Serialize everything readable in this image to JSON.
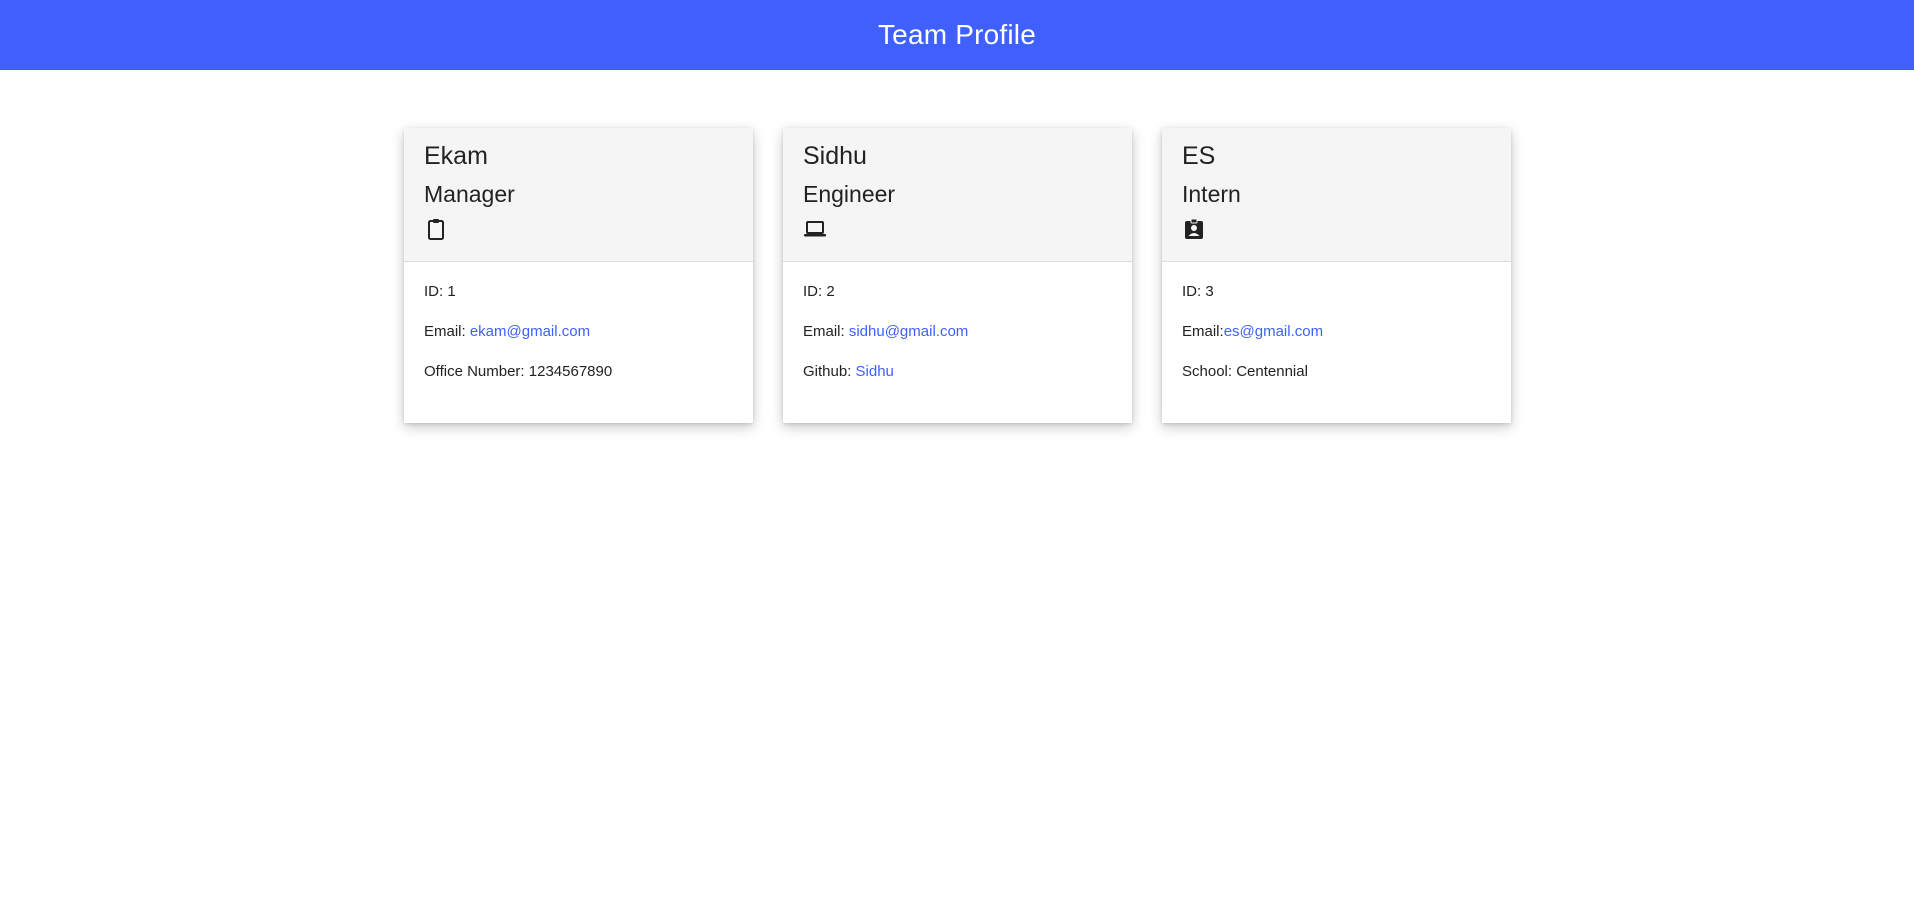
{
  "header": {
    "title": "Team Profile"
  },
  "cards": [
    {
      "name": "Ekam",
      "role": "Manager",
      "icon": "clipboard-icon",
      "id_text": "ID: 1",
      "email_label": "Email: ",
      "email": "ekam@gmail.com",
      "extra_label": "Office Number: ",
      "extra_value": "1234567890"
    },
    {
      "name": "Sidhu",
      "role": "Engineer",
      "icon": "laptop-icon",
      "id_text": "ID: 2",
      "email_label": "Email: ",
      "email": "sidhu@gmail.com",
      "extra_label": "Github: ",
      "extra_value": "Sidhu"
    },
    {
      "name": "ES",
      "role": "Intern",
      "icon": "student-badge-icon",
      "id_text": "ID: 3",
      "email_label": "Email:",
      "email": "es@gmail.com",
      "extra_label": "School: ",
      "extra_value": "Centennial"
    }
  ],
  "colors": {
    "header_bg": "#3f60fd",
    "link": "#3f60fd",
    "card_header_bg": "#f5f5f5"
  }
}
